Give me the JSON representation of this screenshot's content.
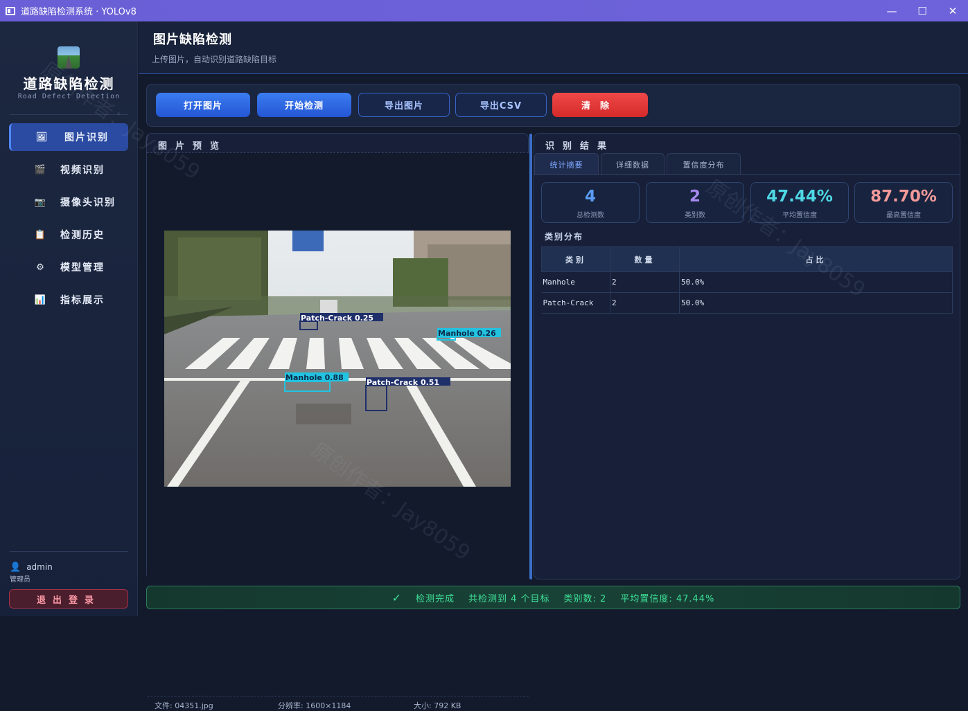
{
  "window": {
    "title": "道路缺陷检测系统 · YOLOv8",
    "minimize": "—",
    "maximize": "☐",
    "close": "✕"
  },
  "sidebar": {
    "brand_title": "道路缺陷检测",
    "brand_sub": "Road Defect Detection",
    "items": [
      {
        "label": "图片识别",
        "icon": "🖼"
      },
      {
        "label": "视频识别",
        "icon": "🎬"
      },
      {
        "label": "摄像头识别",
        "icon": "📷"
      },
      {
        "label": "检测历史",
        "icon": "📋"
      },
      {
        "label": "模型管理",
        "icon": "⚙"
      },
      {
        "label": "指标展示",
        "icon": "📊"
      }
    ],
    "user": {
      "name": "admin",
      "role": "管理员"
    },
    "logout": "退出登录"
  },
  "header": {
    "title": "图片缺陷检测",
    "subtitle": "上传图片，自动识别道路缺陷目标"
  },
  "toolbar": {
    "open": "打开图片",
    "detect": "开始检测",
    "export_img": "导出图片",
    "export_csv": "导出CSV",
    "clear": "清除"
  },
  "preview": {
    "title": "图片预览",
    "detections": [
      {
        "label": "Patch-Crack 0.25"
      },
      {
        "label": "Manhole 0.26"
      },
      {
        "label": "Manhole 0.88"
      },
      {
        "label": "Patch-Crack 0.51"
      }
    ],
    "file": "文件: 04351.jpg",
    "resolution": "分辨率: 1600×1184",
    "size": "大小: 792 KB"
  },
  "results": {
    "title": "识别结果",
    "tabs": [
      "统计摘要",
      "详细数据",
      "置信度分布"
    ],
    "stats": [
      {
        "value": "4",
        "label": "总检测数",
        "color": "#5b9cf5"
      },
      {
        "value": "2",
        "label": "类别数",
        "color": "#a58af0"
      },
      {
        "value": "47.44%",
        "label": "平均置信度",
        "color": "#4fd8e6"
      },
      {
        "value": "87.70%",
        "label": "最高置信度",
        "color": "#f29a9a"
      }
    ],
    "section_title": "类别分布",
    "table": {
      "headers": [
        "类别",
        "数量",
        "占比"
      ],
      "rows": [
        [
          "Manhole",
          "2",
          "50.0%"
        ],
        [
          "Patch-Crack",
          "2",
          "50.0%"
        ]
      ]
    }
  },
  "status": {
    "check": "✓",
    "done": "检测完成",
    "total": "共检测到 4 个目标",
    "classes": "类别数: 2",
    "avg": "平均置信度: 47.44%"
  },
  "watermark": {
    "text": "原创作者：Jay8059"
  }
}
